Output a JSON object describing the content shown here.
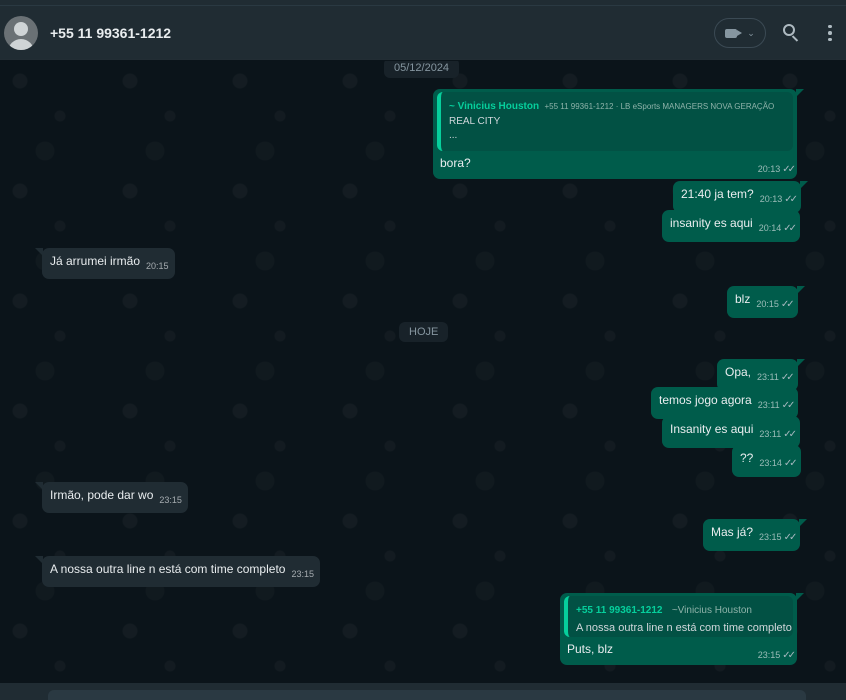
{
  "header": {
    "contact_name": "+55 11 99361-1212",
    "icons": [
      "avatar-icon",
      "video-call-icon",
      "chevron-down-icon",
      "search-icon",
      "menu-icon"
    ]
  },
  "chat": {
    "date_chip_1": "05/12/2024",
    "date_chip_2": "HOJE",
    "messages": [
      {
        "direction": "out",
        "quote": {
          "author": "~ Vinicius Houston",
          "sub": "+55 11 99361-1212 · LB eSports MANAGERS NOVA GERAÇÃO",
          "line1": "REAL CITY",
          "line2": "..."
        },
        "text": "bora?",
        "time": "20:13",
        "status": "read"
      },
      {
        "direction": "out",
        "text": "21:40 ja tem?",
        "time": "20:13",
        "status": "read"
      },
      {
        "direction": "out",
        "text": "insanity es aqui",
        "time": "20:14",
        "status": "read"
      },
      {
        "direction": "in",
        "text": "Já arrumei irmão",
        "time": "20:15"
      },
      {
        "direction": "out",
        "text": "blz",
        "time": "20:15",
        "status": "read"
      },
      {
        "direction": "out",
        "text": "Opa,",
        "time": "23:11",
        "status": "read"
      },
      {
        "direction": "out",
        "text": "temos jogo agora",
        "time": "23:11",
        "status": "read"
      },
      {
        "direction": "out",
        "text": "Insanity es aqui",
        "time": "23:11",
        "status": "read"
      },
      {
        "direction": "out",
        "text": "??",
        "time": "23:14",
        "status": "read"
      },
      {
        "direction": "in",
        "text": "Irmão, pode dar wo",
        "time": "23:15"
      },
      {
        "direction": "out",
        "text": "Mas já?",
        "time": "23:15",
        "status": "read"
      },
      {
        "direction": "in",
        "text": "A nossa outra line n está com time completo",
        "time": "23:15"
      },
      {
        "direction": "out",
        "quote": {
          "author": "+55 11 99361-1212",
          "sub": "~Vinicius Houston",
          "line1": "A nossa outra line n está com time completo"
        },
        "text": "Puts, blz",
        "time": "23:15",
        "status": "read"
      }
    ]
  },
  "colors": {
    "outgoing_bubble": "#005c4b",
    "incoming_bubble": "#202c33",
    "background": "#0b141a",
    "accent": "#06cf9c"
  }
}
